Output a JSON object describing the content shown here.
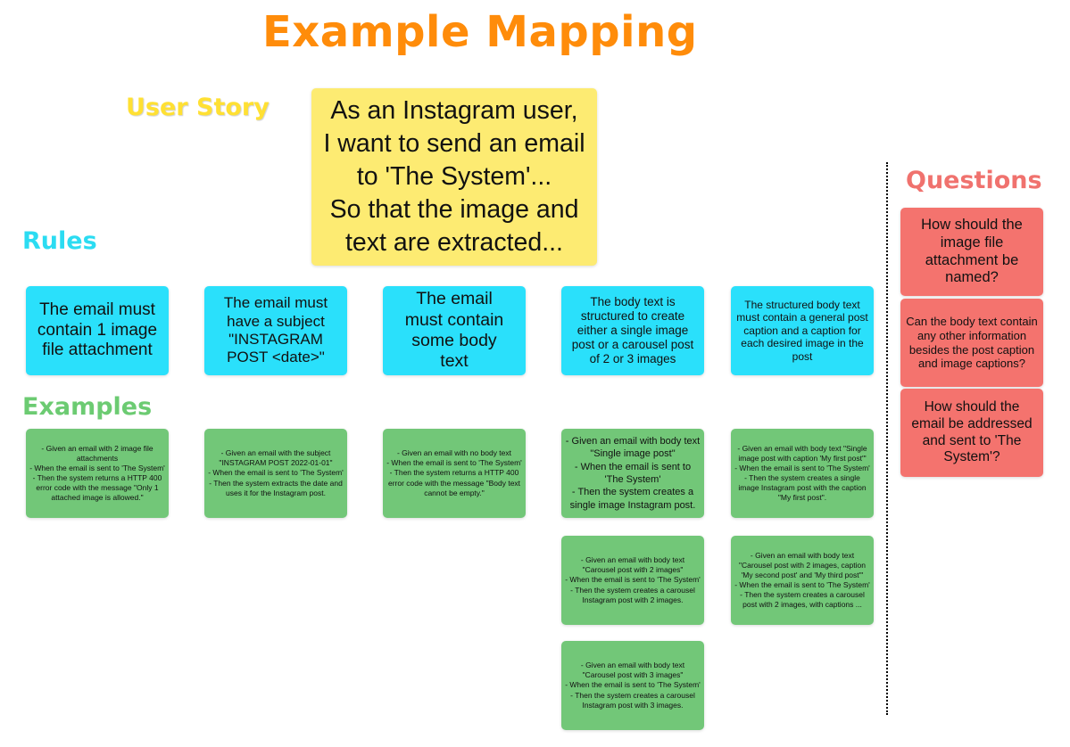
{
  "title": "Example Mapping",
  "sections": {
    "user_story": "User Story",
    "rules": "Rules",
    "examples": "Examples",
    "questions": "Questions"
  },
  "colors": {
    "title": "#ff8c0a",
    "user_story": "#fdeb72",
    "rules": "#2ae0fb",
    "examples": "#72c778",
    "questions": "#f4736e"
  },
  "user_story": {
    "text": "As an Instagram user,\nI want to send an email to 'The System'...\nSo that the image and text are extracted..."
  },
  "rules": [
    {
      "text": "The email must contain 1 image file attachment"
    },
    {
      "text": "The email must have a subject \"INSTAGRAM POST <date>\""
    },
    {
      "text": "The email must contain some body text"
    },
    {
      "text": "The body text is structured to create either a single image post or a carousel post of 2 or 3 images"
    },
    {
      "text": "The structured body text must contain a general post caption and a caption for each desired image in the post"
    }
  ],
  "examples": [
    {
      "rule": 0,
      "text": "- Given an email with 2 image file attachments\n- When the email is sent to 'The System'\n- Then the system returns a HTTP 400 error code with the message \"Only 1 attached image is allowed.\""
    },
    {
      "rule": 1,
      "text": "- Given an email with the subject \"INSTAGRAM POST 2022-01-01\"\n- When the email is sent to 'The System'\n- Then the system  extracts the date and uses it for the Instagram post."
    },
    {
      "rule": 2,
      "text": "- Given an email with no body text\n- When the email is sent to 'The System'\n- Then the system returns a HTTP 400 error code with the message \"Body text cannot be empty.\""
    },
    {
      "rule": 3,
      "text": "- Given an email with body text \"Single image post\"\n- When the email is sent to 'The System'\n- Then the system creates a single image Instagram post."
    },
    {
      "rule": 4,
      "text": "- Given an email with body text \"Single image post with caption 'My first post'\"\n- When the email is sent to 'The System'\n- Then the system creates a single image Instagram post with the caption \"My first post\"."
    },
    {
      "rule": 3,
      "text": "- Given an email with body text \"Carousel post with 2 images\"\n- When the email is sent to 'The System'\n- Then the system creates a carousel Instagram post with 2 images."
    },
    {
      "rule": 4,
      "text": "- Given an email with body text \"Carousel post with 2 images, caption 'My second post' and 'My third post'\"\n- When the email is sent to 'The System'\n- Then the system creates a carousel post with 2 images, with captions ..."
    },
    {
      "rule": 3,
      "text": "- Given an email with body text \"Carousel post with 3 images\"\n- When the email is sent to 'The System'\n- Then the system creates a carousel Instagram post with 3 images."
    }
  ],
  "questions": [
    {
      "text": "How should the image file attachment be named?"
    },
    {
      "text": "Can the body text contain any other information besides the post caption and image captions?"
    },
    {
      "text": "How should the email be addressed and sent to 'The System'?"
    }
  ]
}
